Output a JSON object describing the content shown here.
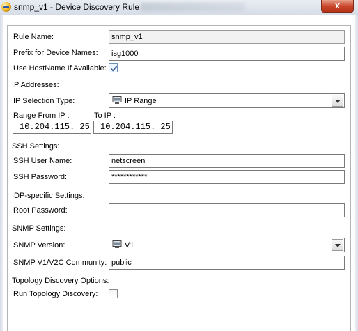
{
  "window": {
    "title": "snmp_v1 - Device Discovery Rule",
    "close_label": "x"
  },
  "rule": {
    "name_label": "Rule Name:",
    "name_value": "snmp_v1",
    "prefix_label": "Prefix for Device Names:",
    "prefix_value": "isg1000",
    "hostname_label": "Use HostName If Available:",
    "hostname_checked": true
  },
  "ip": {
    "section_label": "IP Addresses:",
    "selection_label": "IP Selection Type:",
    "selection_value": "IP Range",
    "selection_icon": "computer-icon",
    "range_from_label": "Range From IP :",
    "to_label": "To IP :",
    "range_from_value": "10.204.115. 25",
    "to_value": "10.204.115. 25"
  },
  "ssh": {
    "section_label": "SSH Settings:",
    "user_label": "SSH User Name:",
    "user_value": "netscreen",
    "password_label": "SSH Password:",
    "password_value": "************"
  },
  "idp": {
    "section_label": "IDP-specific Settings:",
    "root_label": "Root Password:",
    "root_value": ""
  },
  "snmp": {
    "section_label": "SNMP Settings:",
    "version_label": "SNMP Version:",
    "version_value": "V1",
    "version_icon": "computer-icon",
    "community_label": "SNMP V1/V2C Community:",
    "community_value": "public"
  },
  "topology": {
    "section_label": "Topology Discovery Options:",
    "run_label": "Run Topology Discovery:",
    "run_checked": false
  },
  "colors": {
    "check_mark": "#3b5f96",
    "close_button": "#c7432a"
  }
}
